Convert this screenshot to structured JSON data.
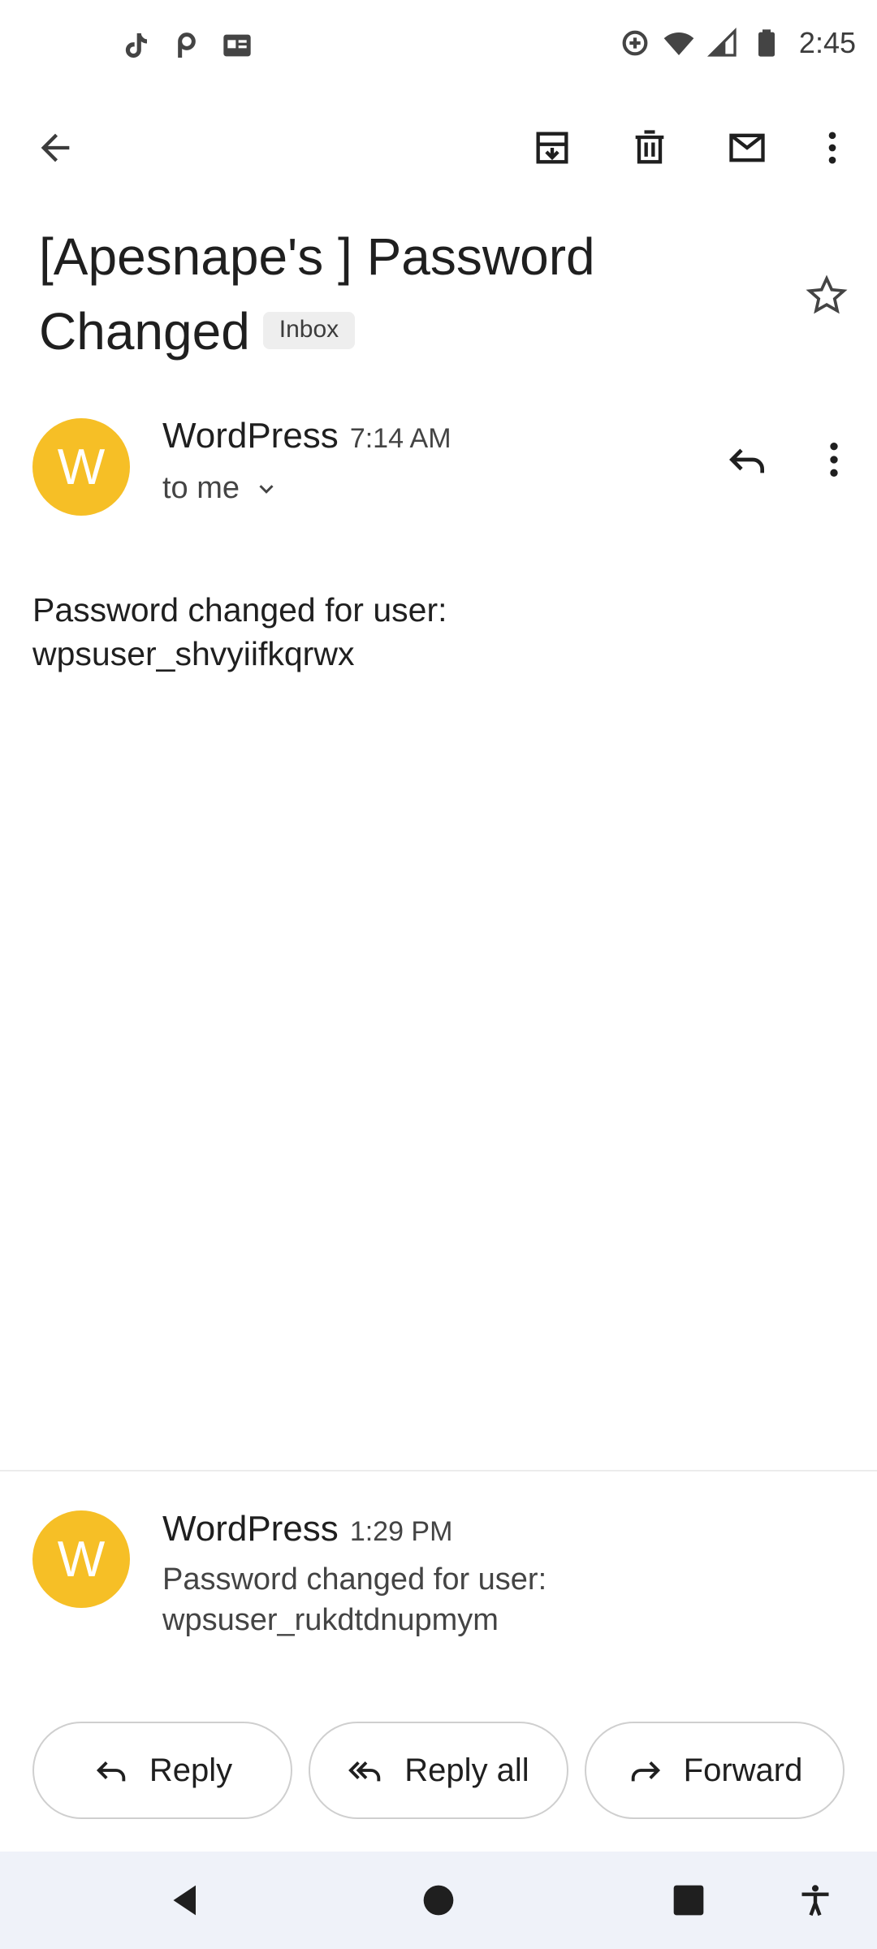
{
  "status_bar": {
    "time": "2:45",
    "left_icons": [
      "tiktok-icon",
      "pocket-icon",
      "news-icon"
    ],
    "right_icons": [
      "data-saver-icon",
      "wifi-icon",
      "signal-icon",
      "battery-icon"
    ]
  },
  "toolbar": {
    "icons": [
      "back-arrow-icon",
      "archive-icon",
      "delete-icon",
      "mark-unread-icon",
      "more-vert-icon"
    ]
  },
  "email": {
    "subject": "[Apesnape's ] Password Changed",
    "label_chip": "Inbox",
    "starred": false
  },
  "message1": {
    "avatar_letter": "W",
    "sender": "WordPress",
    "time": "7:14 AM",
    "recipient": "to me",
    "body_line1": "Password changed for user:",
    "body_line2": "wpsuser_shvyiifkqrwx"
  },
  "message2": {
    "avatar_letter": "W",
    "sender": "WordPress",
    "time": "1:29 PM",
    "snippet_line1": "Password changed for user:",
    "snippet_line2": "wpsuser_rukdtdnupmym"
  },
  "actions": {
    "reply": "Reply",
    "reply_all": "Reply all",
    "forward": "Forward"
  },
  "colors": {
    "avatar": "#f6bf26",
    "nav_bar": "#eff2f9",
    "chip_bg": "#eeeeee"
  }
}
